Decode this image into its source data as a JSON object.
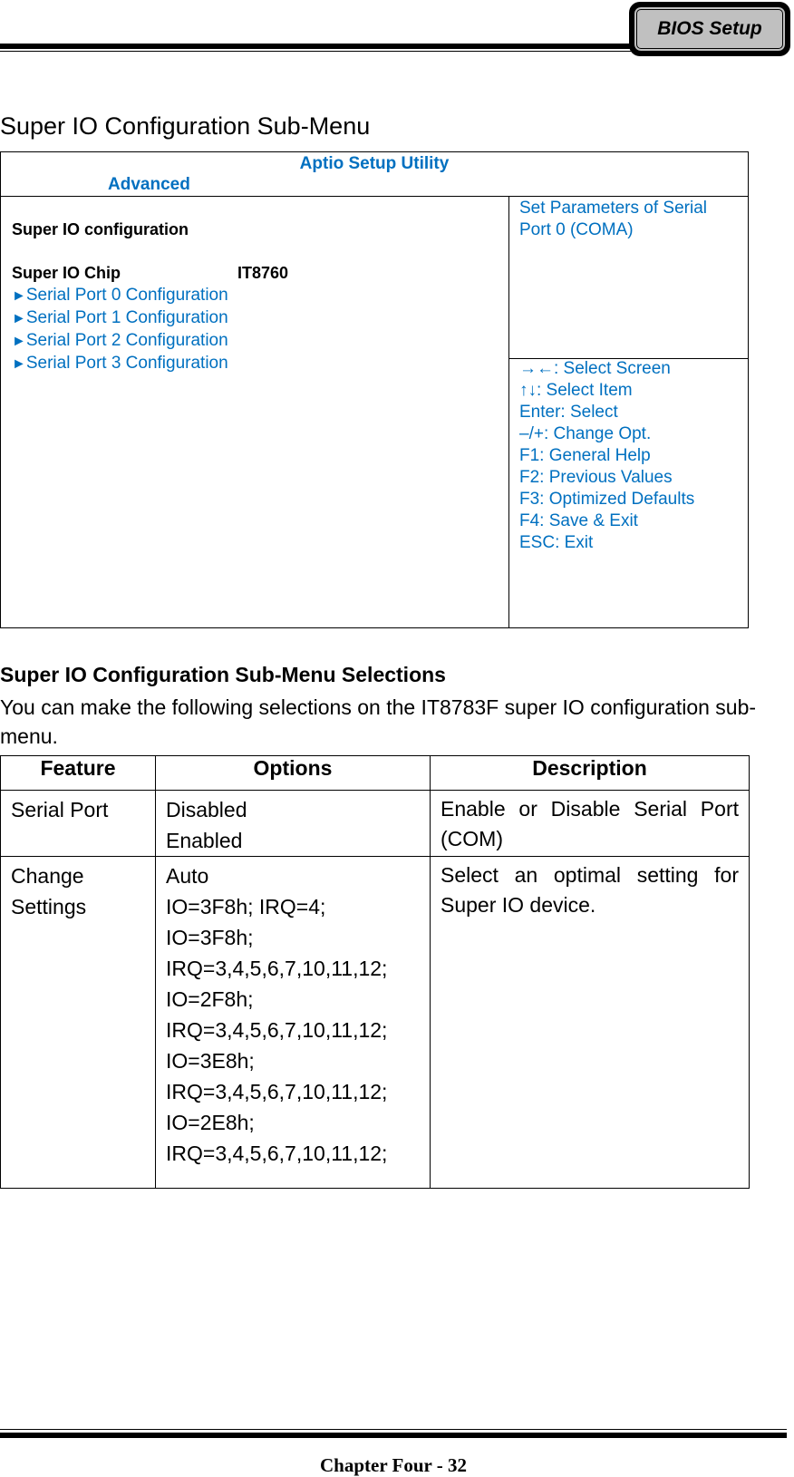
{
  "header": {
    "badge_label": "BIOS Setup"
  },
  "section_title": "Super IO Configuration Sub-Menu",
  "bios_screen": {
    "utility_title": "Aptio Setup Utility",
    "active_tab": "Advanced",
    "config_title": "Super IO configuration",
    "chip_label": "Super IO Chip",
    "chip_value": "IT8760",
    "submenu_arrow": "►",
    "submenus": [
      "Serial Port 0 Configuration",
      "Serial Port 1 Configuration",
      "Serial Port 2 Configuration",
      "Serial Port 3 Configuration"
    ],
    "help_text": "Set Parameters of Serial Port 0 (COMA)",
    "key_hints": [
      "→←: Select Screen",
      "↑↓: Select Item",
      "Enter: Select",
      "–/+: Change Opt.",
      "F1: General Help",
      "F2: Previous Values",
      "F3: Optimized Defaults",
      "F4: Save & Exit",
      "ESC: Exit"
    ],
    "accent_color": "#0070c0"
  },
  "selections": {
    "title": "Super IO Configuration Sub-Menu Selections",
    "description": "You can make the following selections on the IT8783F super IO configuration sub-menu.",
    "table": {
      "headers": [
        "Feature",
        "Options",
        "Description"
      ],
      "rows": [
        {
          "feature": "Serial Port",
          "options": [
            "Disabled",
            "Enabled"
          ],
          "description": "Enable or Disable Serial Port (COM)"
        },
        {
          "feature": "Change Settings",
          "options": [
            "Auto",
            "IO=3F8h; IRQ=4;",
            "IO=3F8h;",
            "IRQ=3,4,5,6,7,10,11,12;",
            "IO=2F8h;",
            "IRQ=3,4,5,6,7,10,11,12;",
            "IO=3E8h;",
            "IRQ=3,4,5,6,7,10,11,12;",
            "IO=2E8h;",
            "IRQ=3,4,5,6,7,10,11,12;"
          ],
          "description": "Select an optimal setting for Super IO device."
        }
      ]
    }
  },
  "footer": {
    "page_label": "Chapter Four - 32"
  }
}
